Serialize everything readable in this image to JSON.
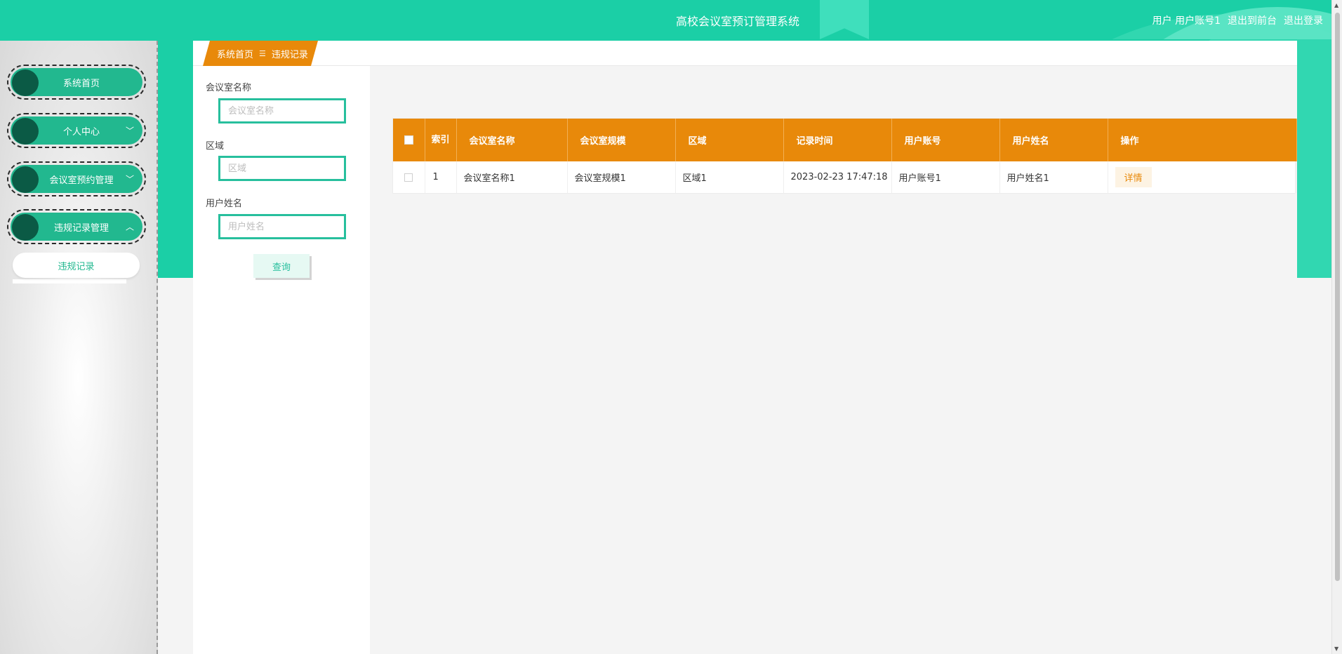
{
  "header": {
    "title": "高校会议室预订管理系统",
    "user_role": "用户",
    "user_account": "用户账号1",
    "exit_front": "退出到前台",
    "logout": "退出登录"
  },
  "sidebar": {
    "items": [
      {
        "label": "系统首页",
        "chevron": ""
      },
      {
        "label": "个人中心",
        "chevron": "﹀"
      },
      {
        "label": "会议室预约管理",
        "chevron": "﹀"
      },
      {
        "label": "违规记录管理",
        "chevron": "︿"
      }
    ],
    "submenu": {
      "label": "违规记录"
    }
  },
  "breadcrumb": {
    "home": "系统首页",
    "separator": "☰",
    "current": "违规记录"
  },
  "search": {
    "fields": [
      {
        "label": "会议室名称",
        "placeholder": "会议室名称",
        "value": ""
      },
      {
        "label": "区域",
        "placeholder": "区域",
        "value": ""
      },
      {
        "label": "用户姓名",
        "placeholder": "用户姓名",
        "value": ""
      }
    ],
    "button": "查询"
  },
  "table": {
    "headers": {
      "index": "索引",
      "room_name": "会议室名称",
      "room_scale": "会议室规模",
      "area": "区域",
      "record_time": "记录时间",
      "user_account": "用户账号",
      "user_name": "用户姓名",
      "actions": "操作"
    },
    "rows": [
      {
        "index": "1",
        "room_name": "会议室名称1",
        "room_scale": "会议室规模1",
        "area": "区域1",
        "record_time": "2023-02-23 17:47:18",
        "user_account": "用户账号1",
        "user_name": "用户姓名1",
        "action_label": "详情"
      }
    ]
  },
  "colors": {
    "primary": "#1bcfa6",
    "menu": "#22b88f",
    "accent": "#e8890a"
  }
}
